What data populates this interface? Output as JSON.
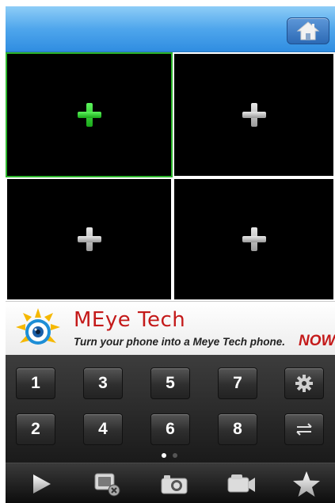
{
  "header": {
    "home_icon": "home-icon"
  },
  "grid": {
    "cells": [
      {
        "icon": "add-camera-icon",
        "selected": true
      },
      {
        "icon": "add-camera-icon",
        "selected": false
      },
      {
        "icon": "add-camera-icon",
        "selected": false
      },
      {
        "icon": "add-camera-icon",
        "selected": false
      }
    ]
  },
  "ad": {
    "title": "MEye Tech",
    "tagline": "Turn your phone into a Meye Tech phone.",
    "cta": "NOW !"
  },
  "keypad": {
    "row1": [
      "1",
      "3",
      "5",
      "7"
    ],
    "row2": [
      "2",
      "4",
      "6",
      "8"
    ],
    "settings_icon": "gear-icon",
    "swap_icon": "swap-arrows-icon",
    "page_count": 2,
    "active_page": 1
  },
  "toolbar": {
    "icons": [
      "play-icon",
      "close-view-icon",
      "camera-icon",
      "video-camera-icon",
      "star-icon"
    ]
  },
  "colors": {
    "header_blue": "#4fa6ec",
    "selected_border": "#2cb52c",
    "ad_red": "#c41a1a"
  }
}
